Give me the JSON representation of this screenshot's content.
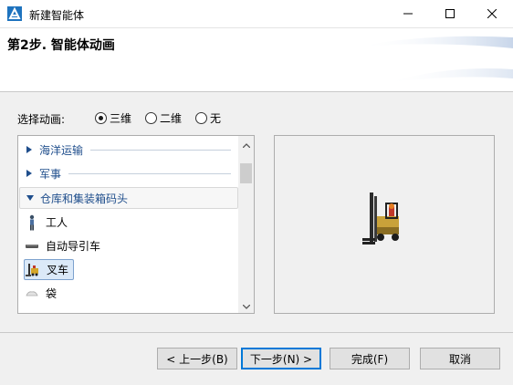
{
  "window": {
    "title": "新建智能体",
    "app_icon": "anylogic-app-icon",
    "controls": [
      "minimize-icon",
      "maximize-icon",
      "close-icon"
    ]
  },
  "header": {
    "step_title": "第2步. 智能体动画"
  },
  "animation_choice": {
    "label": "选择动画:",
    "options": [
      {
        "label": "三维",
        "checked": true
      },
      {
        "label": "二维",
        "checked": false
      },
      {
        "label": "无",
        "checked": false
      }
    ]
  },
  "list": {
    "groups": [
      {
        "label": "海洋运输",
        "expanded": false
      },
      {
        "label": "军事",
        "expanded": false
      },
      {
        "label": "仓库和集装箱码头",
        "expanded": true
      }
    ],
    "items": [
      {
        "label": "工人",
        "icon": "worker-icon",
        "selected": false
      },
      {
        "label": "自动导引车",
        "icon": "agv-icon",
        "selected": false
      },
      {
        "label": "叉车",
        "icon": "forklift-icon",
        "selected": true
      },
      {
        "label": "袋",
        "icon": "bag-icon",
        "selected": false
      }
    ]
  },
  "preview": {
    "icon": "forklift-preview-icon"
  },
  "buttons": {
    "back": "< 上一步(B)",
    "next": "下一步(N) >",
    "finish": "完成(F)",
    "cancel": "取消"
  },
  "colors": {
    "accent": "#0078d7",
    "group_text": "#1f4e8c",
    "selection_bg": "#dbe9f8"
  }
}
